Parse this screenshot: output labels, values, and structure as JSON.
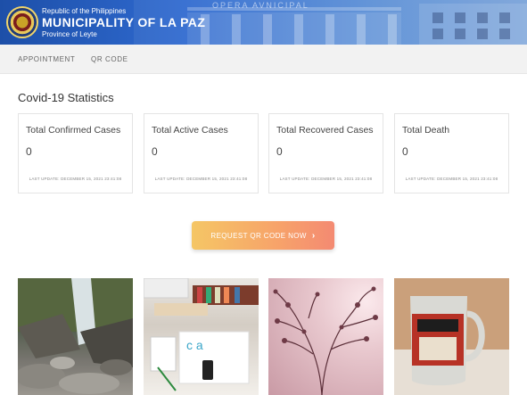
{
  "header": {
    "republic": "Republic of the Philippines",
    "municipality": "MUNICIPALITY OF LA PAZ",
    "province": "Province of Leyte",
    "building_inscription": "OPERA AVNICIPAL"
  },
  "nav": {
    "items": [
      "APPOINTMENT",
      "QR CODE"
    ]
  },
  "stats": {
    "title": "Covid-19 Statistics",
    "cards": [
      {
        "label": "Total Confirmed Cases",
        "value": "0",
        "updated": "LAST UPDATE: DECEMBER 15, 2021 23:41:08"
      },
      {
        "label": "Total Active Cases",
        "value": "0",
        "updated": "LAST UPDATE: DECEMBER 15, 2021 23:41:08"
      },
      {
        "label": "Total Recovered Cases",
        "value": "0",
        "updated": "LAST UPDATE: DECEMBER 15, 2021 23:41:08"
      },
      {
        "label": "Total Death",
        "value": "0",
        "updated": "LAST UPDATE: DECEMBER 15, 2021 23:41:08"
      }
    ]
  },
  "cta": {
    "label": "REQUEST QR CODE NOW",
    "icon": "chevron-right-icon"
  },
  "gallery": {
    "images": [
      "waterfall-photo",
      "desk-photo",
      "branches-photo",
      "coffee-mug-photo"
    ]
  },
  "colors": {
    "header_blue": "#2f6ad0",
    "cta_start": "#f5c665",
    "cta_end": "#f48a72"
  }
}
